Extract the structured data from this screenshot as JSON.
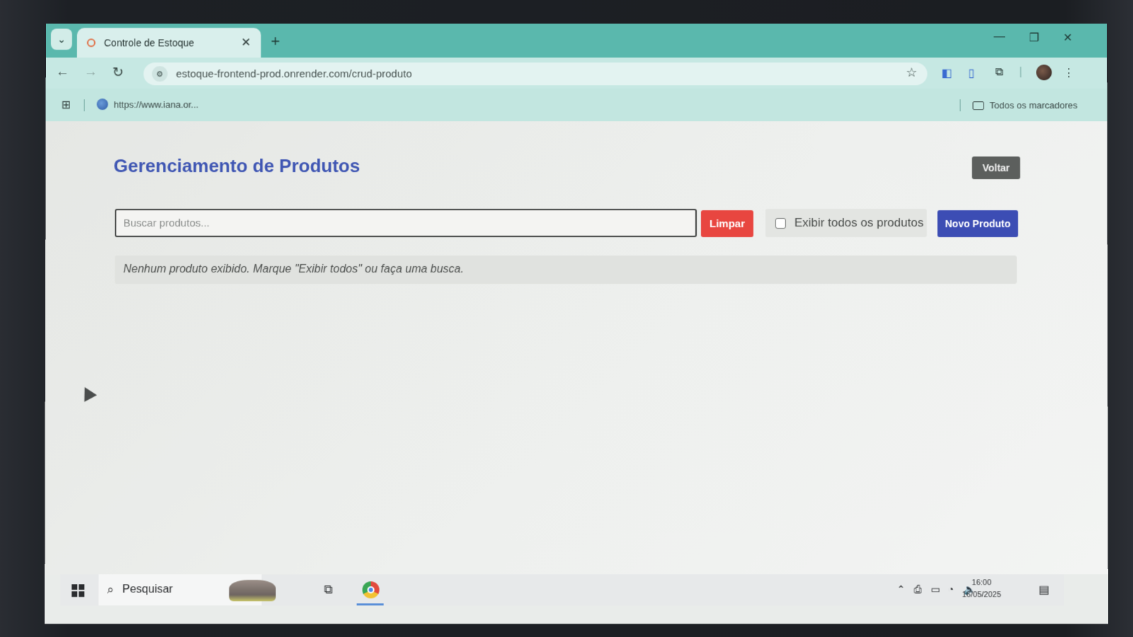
{
  "browser": {
    "tab_title": "Controle de Estoque",
    "tab_close": "✕",
    "new_tab": "+",
    "url": "estoque-frontend-prod.onrender.com/crud-produto",
    "bookmark_url": "https://www.iana.or...",
    "all_bookmarks": "Todos os marcadores"
  },
  "page": {
    "title": "Gerenciamento de Produtos",
    "back_button": "Voltar",
    "search_placeholder": "Buscar produtos...",
    "clear_button": "Limpar",
    "show_all_label": "Exibir todos os produtos",
    "show_all_checked": false,
    "new_button": "Novo Produto",
    "empty_message": "Nenhum produto exibido. Marque \"Exibir todos\" ou faça uma busca."
  },
  "taskbar": {
    "search_label": "Pesquisar",
    "time": "16:00",
    "date": "16/05/2025"
  },
  "colors": {
    "title": "#3f56b3",
    "clear": "#e84640",
    "new": "#3c4db4",
    "back": "#5c5f5d",
    "tabbar": "#5ab8ad"
  },
  "icons": [
    "chevron-down-icon",
    "back-icon",
    "forward-icon",
    "reload-icon",
    "site-info-icon",
    "star-icon",
    "apps-icon",
    "globe-icon",
    "folder-icon",
    "windows-start-icon",
    "search-icon",
    "task-view-icon",
    "chrome-icon"
  ]
}
